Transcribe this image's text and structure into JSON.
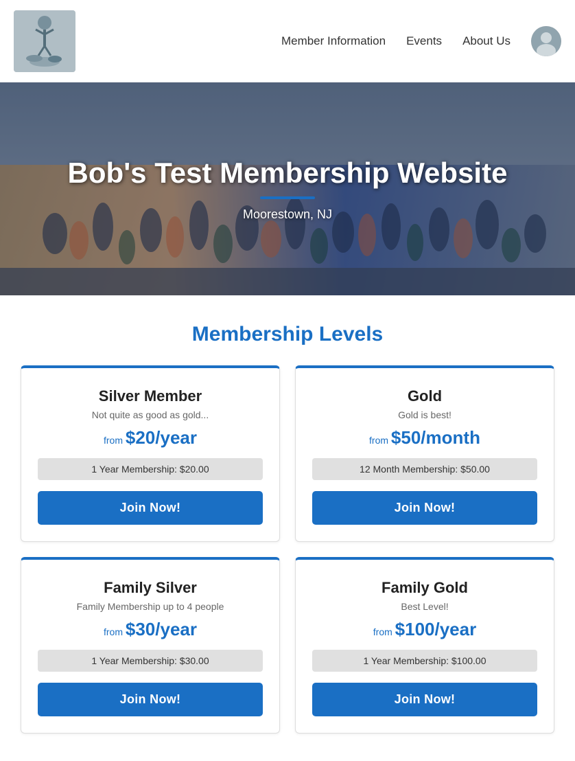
{
  "header": {
    "nav_links": [
      {
        "id": "member-info",
        "label": "Member Information"
      },
      {
        "id": "events",
        "label": "Events"
      },
      {
        "id": "about-us",
        "label": "About Us"
      }
    ]
  },
  "hero": {
    "title": "Bob's Test Membership Website",
    "subtitle": "Moorestown, NJ"
  },
  "main": {
    "section_title": "Membership Levels",
    "cards": [
      {
        "id": "silver-member",
        "title": "Silver Member",
        "desc": "Not quite as good as gold...",
        "price_prefix": "from",
        "price": "$20/year",
        "option_label": "1 Year Membership: $20.00",
        "btn_label": "Join Now!"
      },
      {
        "id": "gold",
        "title": "Gold",
        "desc": "Gold is best!",
        "price_prefix": "from",
        "price": "$50/month",
        "option_label": "12 Month Membership: $50.00",
        "btn_label": "Join Now!"
      },
      {
        "id": "family-silver",
        "title": "Family Silver",
        "desc": "Family Membership up to 4 people",
        "price_prefix": "from",
        "price": "$30/year",
        "option_label": "1 Year Membership: $30.00",
        "btn_label": "Join Now!"
      },
      {
        "id": "family-gold",
        "title": "Family Gold",
        "desc": "Best Level!",
        "price_prefix": "from",
        "price": "$100/year",
        "option_label": "1 Year Membership: $100.00",
        "btn_label": "Join Now!"
      }
    ]
  }
}
